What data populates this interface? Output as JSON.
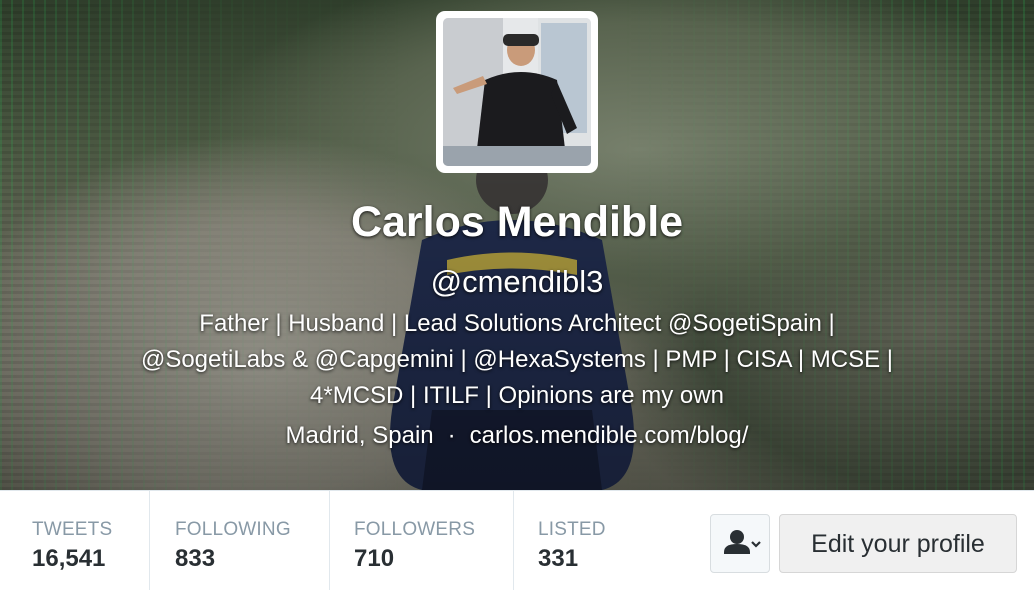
{
  "profile": {
    "name": "Carlos Mendible",
    "handle": "@cmendibl3",
    "bio_lines": [
      "Father | Husband | Lead Solutions Architect @SogetiSpain |",
      "@SogetiLabs & @Capgemini | @HexaSystems | PMP | CISA | MCSE |",
      "4*MCSD | ITILF | Opinions are my own"
    ],
    "location": "Madrid, Spain",
    "separator": "·",
    "website": "carlos.mendible.com/blog/",
    "avatar_icon": "profile-photo",
    "banner_icon": "banner-photo"
  },
  "stats": [
    {
      "label": "TWEETS",
      "value": "16,541"
    },
    {
      "label": "FOLLOWING",
      "value": "833"
    },
    {
      "label": "FOLLOWERS",
      "value": "710"
    },
    {
      "label": "LISTED",
      "value": "331"
    }
  ],
  "actions": {
    "follow_menu_icon": "person-chevron-icon",
    "edit_profile_label": "Edit your profile"
  },
  "colors": {
    "label": "#8899a6",
    "value": "#292f33",
    "divider": "#e1e8ed"
  }
}
